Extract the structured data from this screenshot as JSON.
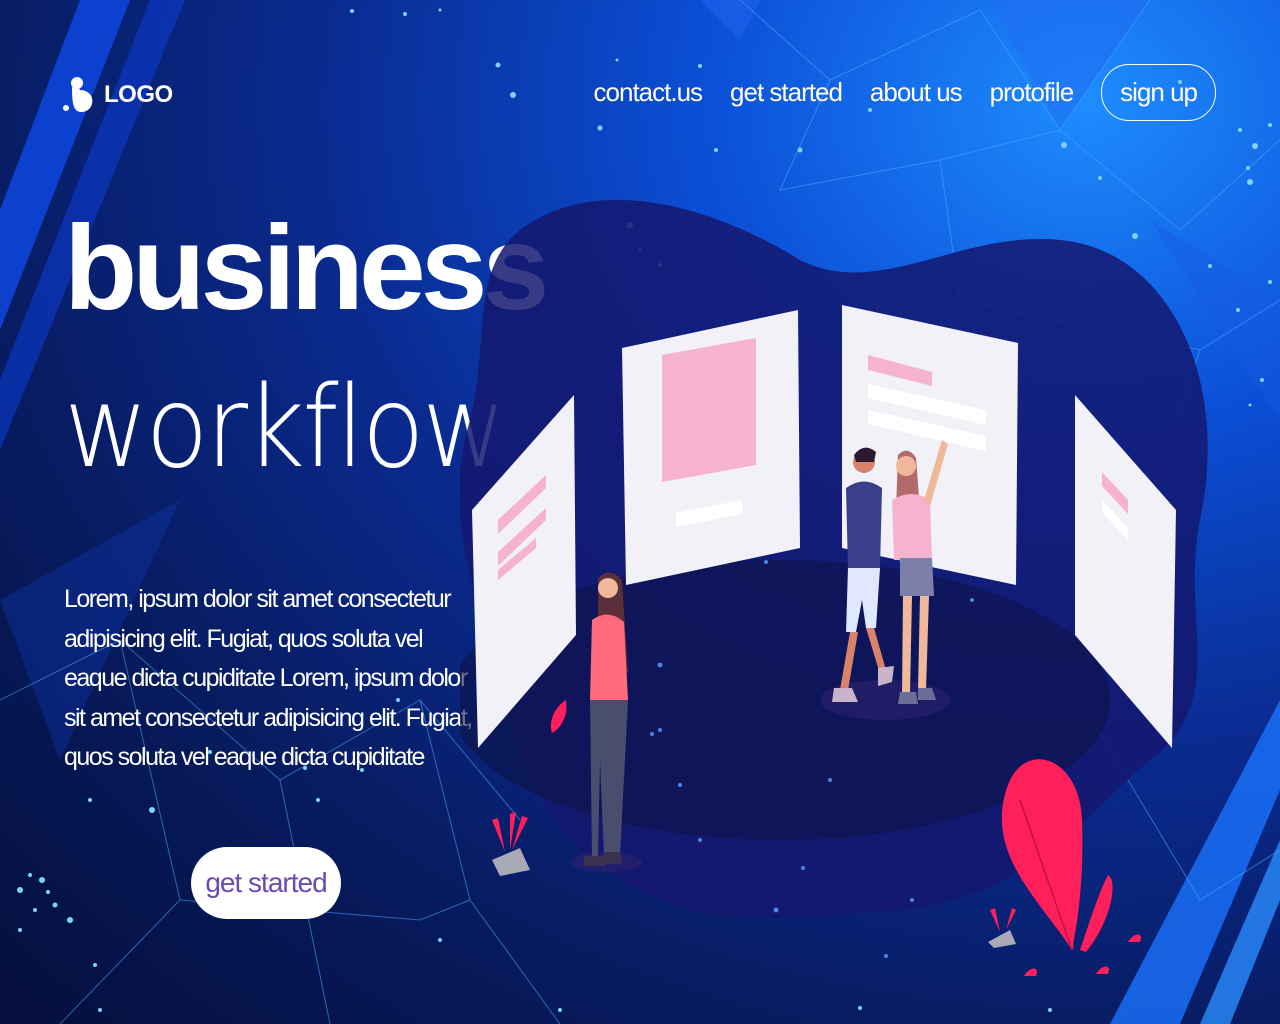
{
  "brand": {
    "logo_text": "LOGO"
  },
  "nav": {
    "items": [
      {
        "label": "contact.us"
      },
      {
        "label": "get started"
      },
      {
        "label": "about us"
      },
      {
        "label": "protofile"
      }
    ],
    "signup_label": "sign up"
  },
  "hero": {
    "title_bold": "business",
    "title_light": "workflow",
    "description": "Lorem, ipsum dolor sit amet consectetur adipisicing elit. Fugiat, quos soluta vel eaque dicta cupiditate Lorem, ipsum dolor sit amet consectetur adipisicing elit. Fugiat, quos soluta vel eaque dicta cupiditate",
    "cta_label": "get started"
  },
  "colors": {
    "accent_pink": "#f6b3cf",
    "plant_red": "#ff1f5a",
    "cta_text": "#6a4bb0"
  }
}
